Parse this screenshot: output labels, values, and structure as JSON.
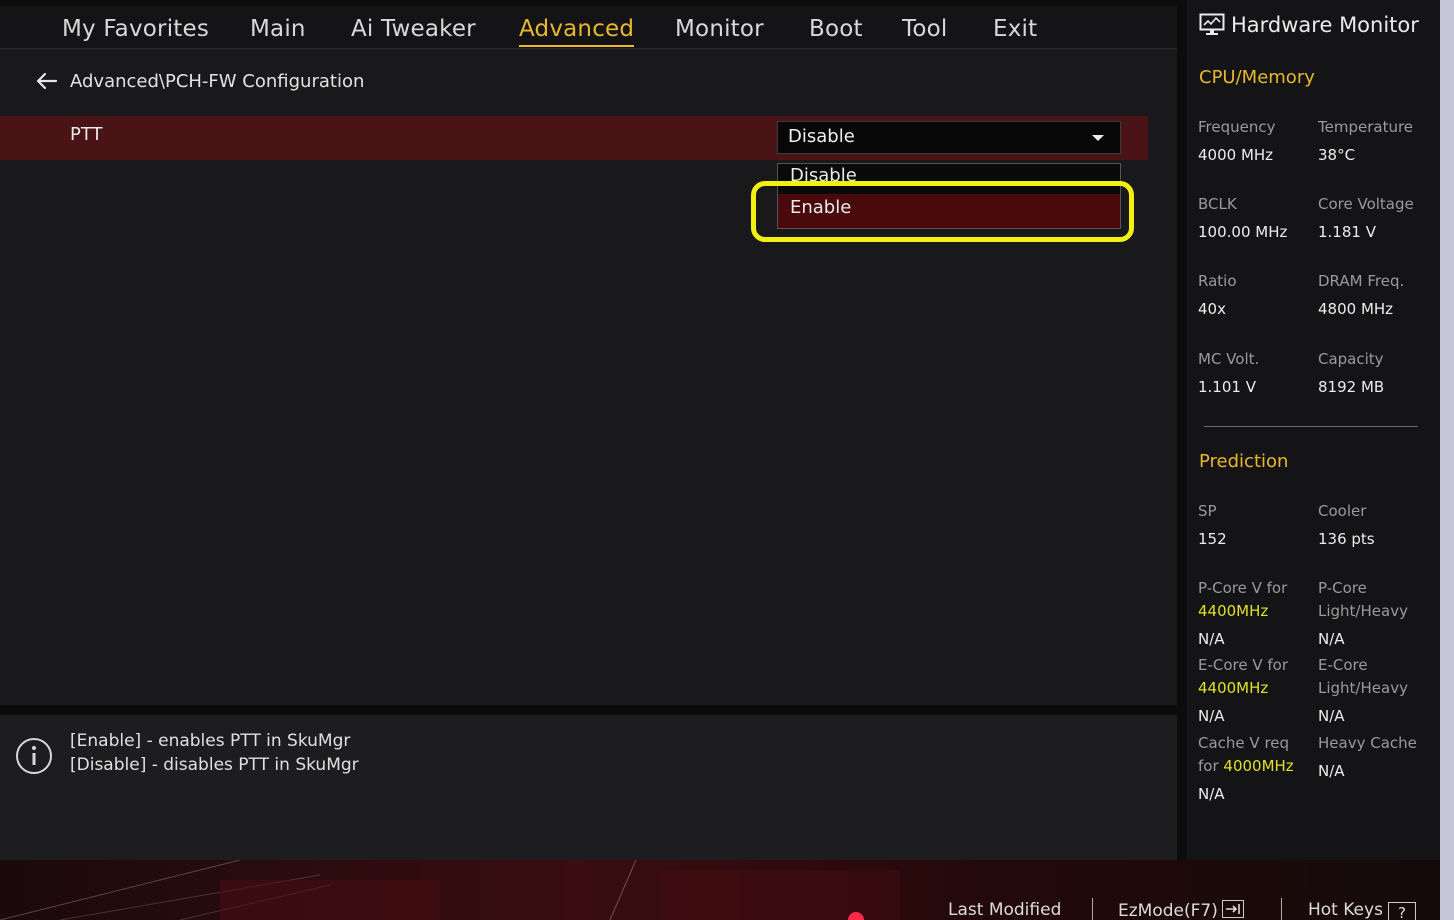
{
  "nav": {
    "tabs": [
      {
        "label": "My Favorites"
      },
      {
        "label": "Main"
      },
      {
        "label": "Ai Tweaker"
      },
      {
        "label": "Advanced"
      },
      {
        "label": "Monitor"
      },
      {
        "label": "Boot"
      },
      {
        "label": "Tool"
      },
      {
        "label": "Exit"
      }
    ],
    "active": "Advanced"
  },
  "breadcrumb": {
    "text": "Advanced\\PCH-FW Configuration"
  },
  "setting": {
    "label": "PTT",
    "value": "Disable",
    "options": [
      "Disable",
      "Enable"
    ],
    "highlighted_option": "Enable"
  },
  "help": {
    "lines": [
      "[Enable] - enables PTT in SkuMgr",
      "[Disable] - disables PTT in SkuMgr"
    ]
  },
  "hw": {
    "title": "Hardware Monitor",
    "cpu_memory": {
      "heading": "CPU/Memory",
      "frequency": {
        "label": "Frequency",
        "value": "4000 MHz"
      },
      "temperature": {
        "label": "Temperature",
        "value": "38°C"
      },
      "bclk": {
        "label": "BCLK",
        "value": "100.00 MHz"
      },
      "core_voltage": {
        "label": "Core Voltage",
        "value": "1.181 V"
      },
      "ratio": {
        "label": "Ratio",
        "value": "40x"
      },
      "dram_freq": {
        "label": "DRAM Freq.",
        "value": "4800 MHz"
      },
      "mc_volt": {
        "label": "MC Volt.",
        "value": "1.101 V"
      },
      "capacity": {
        "label": "Capacity",
        "value": "8192 MB"
      }
    },
    "prediction": {
      "heading": "Prediction",
      "sp": {
        "label": "SP",
        "value": "152"
      },
      "cooler": {
        "label": "Cooler",
        "value": "136 pts"
      },
      "pcore_v": {
        "label_line1": "P-Core V for",
        "freq": "4400MHz",
        "value": "N/A"
      },
      "pcore_lh": {
        "label_line1": "P-Core",
        "label_line2": "Light/Heavy",
        "value": "N/A"
      },
      "ecore_v": {
        "label_line1": "E-Core V for",
        "freq": "4400MHz",
        "value": "N/A"
      },
      "ecore_lh": {
        "label_line1": "E-Core",
        "label_line2": "Light/Heavy",
        "value": "N/A"
      },
      "cache_v": {
        "label_line1": "Cache V req",
        "label_prefix": "for ",
        "freq": "4000MHz",
        "value": "N/A"
      },
      "heavy_cache": {
        "label": "Heavy Cache",
        "value": "N/A"
      }
    }
  },
  "bottom": {
    "last_modified": "Last Modified",
    "ezmode": "EzMode(F7)",
    "hotkeys": "Hot Keys",
    "hotkeys_glyph": "?"
  },
  "colors": {
    "accent": "#e8b730",
    "highlight_ring": "#f2ef12",
    "selected_row": "#4a1416",
    "prediction_freq": "#e0e02a"
  }
}
